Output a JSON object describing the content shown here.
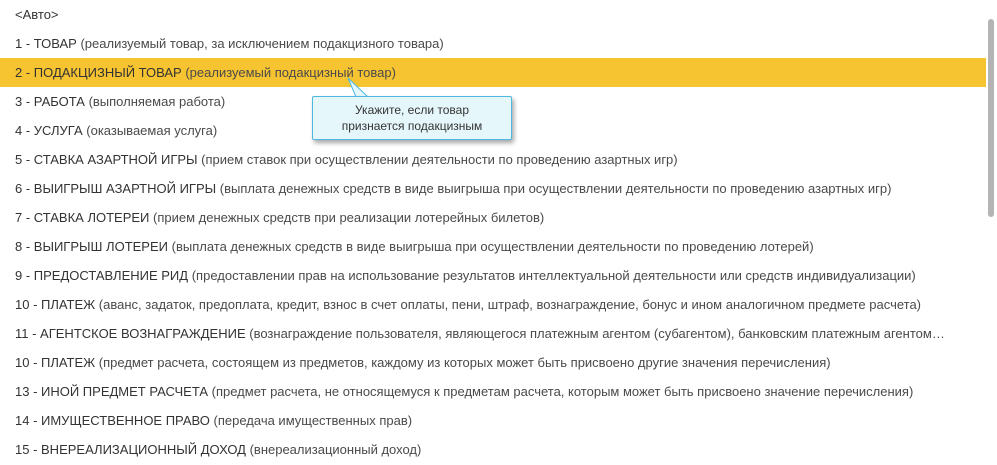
{
  "list": {
    "items": [
      {
        "title": "<Авто>",
        "desc": ""
      },
      {
        "title": "1 - ТОВАР",
        "desc": "(реализуемый товар, за исключением подакцизного товара)"
      },
      {
        "title": "2 - ПОДАКЦИЗНЫЙ ТОВАР",
        "desc": "(реализуемый подакцизный товар)"
      },
      {
        "title": "3 - РАБОТА",
        "desc": "(выполняемая работа)"
      },
      {
        "title": "4 - УСЛУГА",
        "desc": "(оказываемая услуга)"
      },
      {
        "title": "5 - СТАВКА АЗАРТНОЙ ИГРЫ",
        "desc": "(прием ставок при осуществлении деятельности по проведению азартных игр)"
      },
      {
        "title": "6 - ВЫИГРЫШ АЗАРТНОЙ ИГРЫ",
        "desc": "(выплата денежных средств в виде выигрыша при осуществлении деятельности по проведению азартных игр)"
      },
      {
        "title": "7 - СТАВКА ЛОТЕРЕИ",
        "desc": "(прием денежных средств при реализации лотерейных билетов)"
      },
      {
        "title": "8 - ВЫИГРЫШ ЛОТЕРЕИ",
        "desc": "(выплата денежных средств в виде выигрыша при осуществлении деятельности по проведению лотерей)"
      },
      {
        "title": "9 - ПРЕДОСТАВЛЕНИЕ РИД",
        "desc": "(предоставлении прав на использование результатов интеллектуальной деятельности или средств индивидуализации)"
      },
      {
        "title": "10 - ПЛАТЕЖ",
        "desc": "(аванс, задаток, предоплата, кредит, взнос в счет оплаты, пени, штраф, вознаграждение, бонус и ином аналогичном предмете расчета)"
      },
      {
        "title": "11 - АГЕНТСКОЕ ВОЗНАГРАЖДЕНИЕ",
        "desc": "(вознаграждение пользователя, являющегося платежным агентом (субагентом), банковским платежным агентом…"
      },
      {
        "title": "10 - ПЛАТЕЖ",
        "desc": "(предмет расчета, состоящем из предметов, каждому из которых может быть присвоено другие значения перечисления)"
      },
      {
        "title": "13 - ИНОЙ ПРЕДМЕТ РАСЧЕТА",
        "desc": "(предмет расчета, не относящемуся к предметам расчета, которым может быть присвоено значение перечисления)"
      },
      {
        "title": "14 - ИМУЩЕСТВЕННОЕ ПРАВО",
        "desc": "(передача имущественных прав)"
      },
      {
        "title": "15 - ВНЕРЕАЛИЗАЦИОННЫЙ ДОХОД",
        "desc": "(внереализационный доход)"
      }
    ],
    "selected_index": 2
  },
  "tooltip": {
    "line1": "Укажите, если товар",
    "line2": "признается подакцизным"
  },
  "colors": {
    "selected_row": "#f6c431",
    "tooltip_bg": "#e6f7fc",
    "tooltip_border": "#4db9e0",
    "text": "#333333"
  }
}
